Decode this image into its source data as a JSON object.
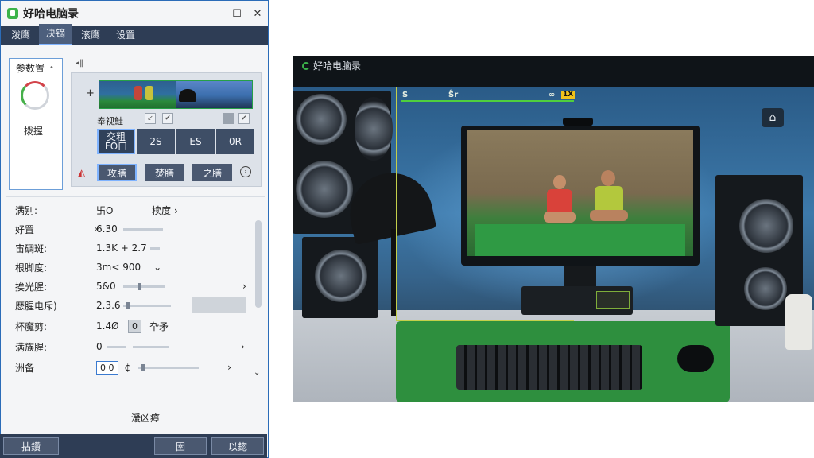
{
  "window": {
    "title": "好哈电脑录",
    "minimize": "—",
    "maximize": "☐",
    "close": "✕"
  },
  "tabs": [
    {
      "label": "泼鹰"
    },
    {
      "label": "决镝"
    },
    {
      "label": "滚鹰"
    },
    {
      "label": "设置"
    }
  ],
  "left_card": {
    "label": "参数置",
    "status": "拨握"
  },
  "panel": {
    "plus": "+",
    "row_label": "奉视鮭",
    "row_btn_1": "↙",
    "row_btn_2": "✔",
    "row_btn_3": "✔",
    "quality_buttons": [
      "交粗\nFO口",
      "2S",
      "ES",
      "0R"
    ],
    "action_buttons": [
      "攻膳",
      "焚膳",
      "之膳"
    ],
    "more_icon": "›"
  },
  "params": [
    {
      "label": "满别:",
      "value": "卐O",
      "extra": "椟度 ›"
    },
    {
      "label": "好置",
      "value": "6.30",
      "end": "›"
    },
    {
      "label": "宙碉斑:",
      "value": "1.3K + 2.7"
    },
    {
      "label": "根脚度:",
      "value": "3m< 900",
      "dropdown": "⌄"
    },
    {
      "label": "挨光腥:",
      "value": "5&0",
      "end": "›"
    },
    {
      "label": "厯腥电斥)",
      "value": "2.3.6"
    },
    {
      "label": "杯魔剪:",
      "value": "1.4Ø",
      "box": "0",
      "extra": "卆矛"
    },
    {
      "label": "满族腥:",
      "value": "0",
      "end": "›"
    },
    {
      "label": "洲备",
      "value": "0 0",
      "extra": "¢",
      "end": "›"
    }
  ],
  "footer": {
    "title": "湲凶瘴",
    "btn_left": "拈鑽",
    "btn_mid": "圉",
    "btn_right": "以鍃"
  },
  "preview": {
    "title": "好哈电脑录",
    "hud_left": "S",
    "hud_mid": "Ŝr",
    "hud_right": "∞",
    "badge": "1X",
    "home_icon": "⌂"
  }
}
